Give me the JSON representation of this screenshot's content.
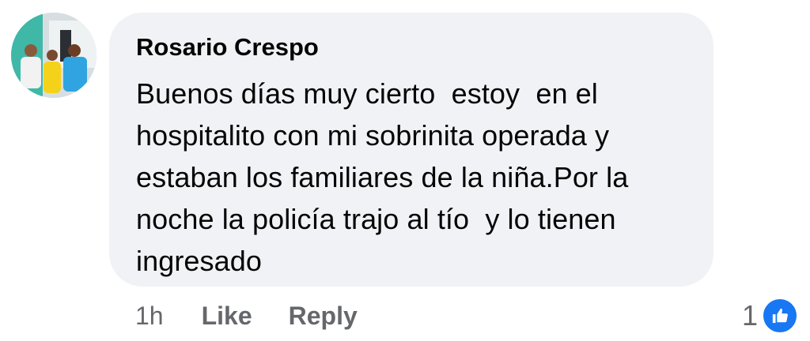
{
  "comment": {
    "author": "Rosario Crespo",
    "text": "Buenos días muy cierto  estoy  en el\nhospitalito con mi sobrinita operada y\nestaban los familiares de la niña.Por la\nnoche la policía trajo al tío  y lo tienen\ningresado",
    "timestamp": "1h",
    "like_label": "Like",
    "reply_label": "Reply",
    "reaction_count": "1",
    "reaction_icon": "like-thumb-icon",
    "colors": {
      "bubble": "#f0f2f5",
      "secondary_text": "#65676b",
      "like_blue": "#1877f2"
    }
  }
}
